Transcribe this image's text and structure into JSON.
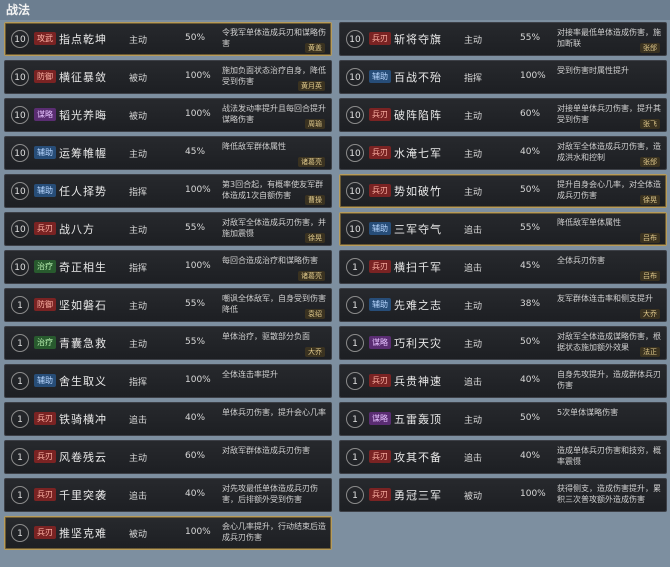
{
  "header": {
    "title": "战法"
  },
  "left": [
    {
      "level": "10",
      "tag": "攻武",
      "tag_color": "red",
      "name": "指点乾坤",
      "type": "主动",
      "rate": "50%",
      "desc": "令我军单体造成兵刃和谋略伤害",
      "owner": "黄盖",
      "gold": true
    },
    {
      "level": "10",
      "tag": "防御",
      "tag_color": "red",
      "name": "横征暴敛",
      "type": "被动",
      "rate": "100%",
      "desc": "施加负面状态治疗自身，降低受到伤害",
      "owner": "黄月英",
      "gold": false
    },
    {
      "level": "10",
      "tag": "谋略",
      "tag_color": "purple",
      "name": "韬光养晦",
      "type": "被动",
      "rate": "100%",
      "desc": "战法发动率提升且每回合提升谋略伤害",
      "owner": "周瑜",
      "gold": false
    },
    {
      "level": "10",
      "tag": "辅助",
      "tag_color": "blue",
      "name": "运筹帷幄",
      "type": "主动",
      "rate": "45%",
      "desc": "降低敌军群体属性",
      "owner": "诸葛亮",
      "gold": false
    },
    {
      "level": "10",
      "tag": "辅助",
      "tag_color": "blue",
      "name": "任人择势",
      "type": "指挥",
      "rate": "100%",
      "desc": "第3回合起，有概率使友军群体造成1次自额伤害",
      "owner": "曹操",
      "gold": false
    },
    {
      "level": "10",
      "tag": "兵刃",
      "tag_color": "red",
      "name": "战八方",
      "type": "主动",
      "rate": "55%",
      "desc": "对敌军全体造成兵刃伤害，并施加震慑",
      "owner": "徐晃",
      "gold": false
    },
    {
      "level": "10",
      "tag": "治疗",
      "tag_color": "green",
      "name": "奇正相生",
      "type": "指挥",
      "rate": "100%",
      "desc": "每回合造成治疗和谋略伤害",
      "owner": "诸葛亮",
      "gold": false
    },
    {
      "level": "1",
      "tag": "防御",
      "tag_color": "red",
      "name": "坚如磐石",
      "type": "主动",
      "rate": "55%",
      "desc": "嘲讽全体敌军，自身受到伤害降低",
      "owner": "袁绍",
      "gold": false
    },
    {
      "level": "1",
      "tag": "治疗",
      "tag_color": "green",
      "name": "青囊急救",
      "type": "主动",
      "rate": "55%",
      "desc": "单体治疗，驱散部分负面",
      "owner": "大乔",
      "gold": false
    },
    {
      "level": "1",
      "tag": "辅助",
      "tag_color": "blue",
      "name": "舍生取义",
      "type": "指挥",
      "rate": "100%",
      "desc": "全体连击率提升",
      "owner": "",
      "gold": false
    },
    {
      "level": "1",
      "tag": "兵刃",
      "tag_color": "red",
      "name": "铁骑横冲",
      "type": "追击",
      "rate": "40%",
      "desc": "单体兵刃伤害，提升会心几率",
      "owner": "",
      "gold": false
    },
    {
      "level": "1",
      "tag": "兵刃",
      "tag_color": "red",
      "name": "风卷残云",
      "type": "主动",
      "rate": "60%",
      "desc": "对敌军群体造成兵刃伤害",
      "owner": "",
      "gold": false
    },
    {
      "level": "1",
      "tag": "兵刃",
      "tag_color": "red",
      "name": "千里突袭",
      "type": "追击",
      "rate": "40%",
      "desc": "对先攻最低单体造成兵刃伤害，后排额外受到伤害",
      "owner": "",
      "gold": false
    },
    {
      "level": "1",
      "tag": "兵刃",
      "tag_color": "red",
      "name": "推坚克难",
      "type": "被动",
      "rate": "100%",
      "desc": "会心几率提升，行动结束后造成兵刃伤害",
      "owner": "",
      "gold": true
    }
  ],
  "right": [
    {
      "level": "10",
      "tag": "兵刃",
      "tag_color": "red",
      "name": "斩将夺旗",
      "type": "主动",
      "rate": "55%",
      "desc": "对接率最低单体造成伤害，施加断联",
      "owner": "张郃",
      "gold": false
    },
    {
      "level": "10",
      "tag": "辅助",
      "tag_color": "blue",
      "name": "百战不殆",
      "type": "指挥",
      "rate": "100%",
      "desc": "受到伤害时属性提升",
      "owner": "",
      "gold": false
    },
    {
      "level": "10",
      "tag": "兵刃",
      "tag_color": "red",
      "name": "破阵陷阵",
      "type": "主动",
      "rate": "60%",
      "desc": "对接单单体兵刃伤害，提升其受到伤害",
      "owner": "张飞",
      "gold": false
    },
    {
      "level": "10",
      "tag": "兵刃",
      "tag_color": "red",
      "name": "水淹七军",
      "type": "主动",
      "rate": "40%",
      "desc": "对敌军全体造成兵刃伤害，造成洪水和控制",
      "owner": "张郃",
      "gold": false
    },
    {
      "level": "10",
      "tag": "兵刃",
      "tag_color": "red",
      "name": "势如破竹",
      "type": "主动",
      "rate": "50%",
      "desc": "提升自身会心几率，对全体造成兵刃伤害",
      "owner": "徐晃",
      "gold": true
    },
    {
      "level": "10",
      "tag": "辅助",
      "tag_color": "blue",
      "name": "三军夺气",
      "type": "追击",
      "rate": "55%",
      "desc": "降低敌军单体属性",
      "owner": "吕布",
      "gold": true
    },
    {
      "level": "1",
      "tag": "兵刃",
      "tag_color": "red",
      "name": "横扫千军",
      "type": "追击",
      "rate": "45%",
      "desc": "全体兵刃伤害",
      "owner": "吕布",
      "gold": false
    },
    {
      "level": "1",
      "tag": "辅助",
      "tag_color": "blue",
      "name": "先难之志",
      "type": "主动",
      "rate": "38%",
      "desc": "友军群体连击率和侧支提升",
      "owner": "大乔",
      "gold": false
    },
    {
      "level": "1",
      "tag": "谋略",
      "tag_color": "purple",
      "name": "巧利天灾",
      "type": "主动",
      "rate": "50%",
      "desc": "对敌军全体造成谋略伤害，根据状态施加额外效果",
      "owner": "法正",
      "gold": false
    },
    {
      "level": "1",
      "tag": "兵刃",
      "tag_color": "red",
      "name": "兵贵神速",
      "type": "追击",
      "rate": "40%",
      "desc": "自身先攻提升，造成群体兵刃伤害",
      "owner": "",
      "gold": false
    },
    {
      "level": "1",
      "tag": "谋略",
      "tag_color": "purple",
      "name": "五雷轰顶",
      "type": "主动",
      "rate": "50%",
      "desc": "5次单体谋略伤害",
      "owner": "",
      "gold": false
    },
    {
      "level": "1",
      "tag": "兵刃",
      "tag_color": "red",
      "name": "攻其不备",
      "type": "追击",
      "rate": "40%",
      "desc": "造成单体兵刃伤害和技穷，概率震慑",
      "owner": "",
      "gold": false
    },
    {
      "level": "1",
      "tag": "兵刃",
      "tag_color": "red",
      "name": "勇冠三军",
      "type": "被动",
      "rate": "100%",
      "desc": "获得侧支，造成伤害提升，累积三次普攻额外造成伤害",
      "owner": "",
      "gold": false
    }
  ]
}
